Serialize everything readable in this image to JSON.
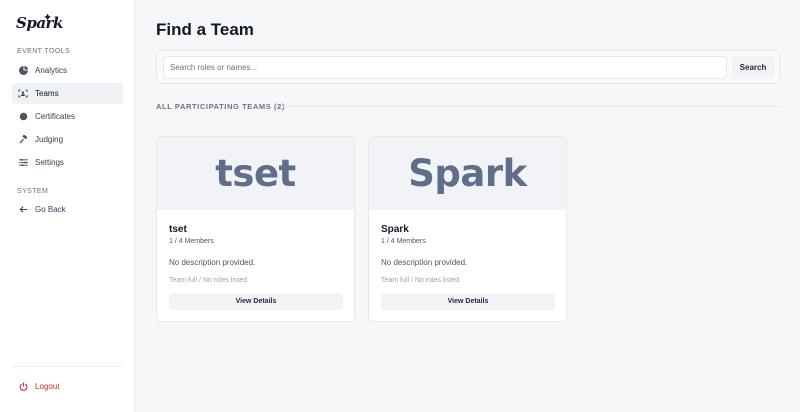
{
  "sidebar": {
    "logo_text": "Spark",
    "event_tools_label": "EVENT TOOLS",
    "event_items": [
      {
        "label": "Analytics",
        "icon": "pie-chart-icon"
      },
      {
        "label": "Teams",
        "icon": "team-scan-icon"
      },
      {
        "label": "Certificates",
        "icon": "certificate-icon"
      },
      {
        "label": "Judging",
        "icon": "gavel-icon"
      },
      {
        "label": "Settings",
        "icon": "sliders-icon"
      }
    ],
    "system_label": "SYSTEM",
    "system_items": [
      {
        "label": "Go Back",
        "icon": "arrow-left-icon"
      }
    ],
    "logout_label": "Logout"
  },
  "main": {
    "title": "Find a Team",
    "search": {
      "placeholder": "Search roles or names...",
      "value": "",
      "button_label": "Search"
    },
    "section_heading": "ALL PARTICIPATING TEAMS (2)",
    "teams": [
      {
        "banner": "tset",
        "name": "tset",
        "members": "1 / 4 Members",
        "description": "No description provided.",
        "status": "Team full / No roles listed",
        "button_label": "View Details"
      },
      {
        "banner": "Spark",
        "name": "Spark",
        "members": "1 / 4 Members",
        "description": "No description provided.",
        "status": "Team full / No roles listed",
        "button_label": "View Details"
      }
    ]
  },
  "colors": {
    "logout": "#dc2626",
    "banner_text": "#5f6f89",
    "active_bg": "#eef1f5"
  }
}
